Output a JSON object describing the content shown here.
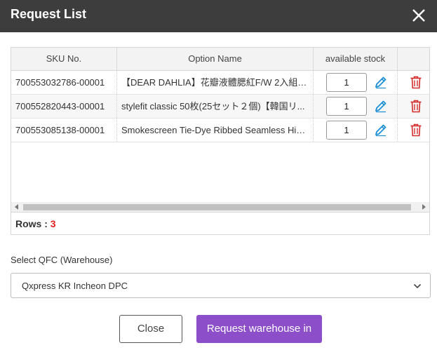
{
  "dialog": {
    "title": "Request List"
  },
  "table": {
    "columns": [
      "SKU No.",
      "Option Name",
      "available stock"
    ],
    "rows": [
      {
        "sku": "700553032786-00001",
        "option": "【DEAR DAHLIA】花瓣液體腮紅F/W 2入組 ...",
        "qty": "1"
      },
      {
        "sku": "700552820443-00001",
        "option": "stylefit classic 50枚(25セット２個)【韓国リ...",
        "qty": "1"
      },
      {
        "sku": "700553085138-00001",
        "option": "Smokescreen Tie-Dye Ribbed Seamless High...",
        "qty": "1"
      }
    ],
    "rows_label": "Rows :",
    "rows_count": "3"
  },
  "warehouse": {
    "label": "Select QFC (Warehouse)",
    "selected": "Qxpress KR Incheon DPC"
  },
  "buttons": {
    "close": "Close",
    "request": "Request warehouse in"
  },
  "colors": {
    "header_bg": "#3d3d3d",
    "primary": "#8d4ec9",
    "edit_icon": "#1b8fd6",
    "delete_icon": "#d42a2a",
    "rows_count": "#e02020"
  },
  "icons": {
    "close": "close-icon",
    "edit": "pencil-icon",
    "delete": "trash-icon",
    "select": "chevron-down-icon"
  }
}
